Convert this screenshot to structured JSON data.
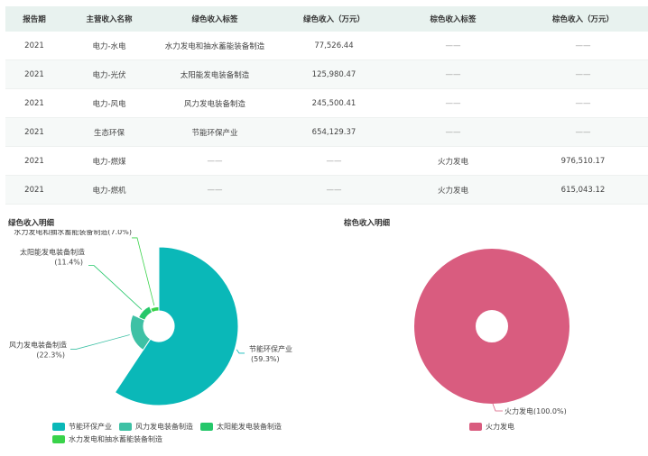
{
  "table": {
    "headers": [
      "报告期",
      "主营收入名称",
      "绿色收入标签",
      "绿色收入（万元）",
      "棕色收入标签",
      "棕色收入（万元）"
    ],
    "rows": [
      [
        "2021",
        "电力-水电",
        "水力发电和抽水蓄能装备制造",
        "77,526.44",
        "——",
        "——"
      ],
      [
        "2021",
        "电力-光伏",
        "太阳能发电装备制造",
        "125,980.47",
        "——",
        "——"
      ],
      [
        "2021",
        "电力-风电",
        "风力发电装备制造",
        "245,500.41",
        "——",
        "——"
      ],
      [
        "2021",
        "生态环保",
        "节能环保产业",
        "654,129.37",
        "——",
        "——"
      ],
      [
        "2021",
        "电力-燃煤",
        "——",
        "——",
        "火力发电",
        "976,510.17"
      ],
      [
        "2021",
        "电力-燃机",
        "——",
        "——",
        "火力发电",
        "615,043.12"
      ]
    ]
  },
  "green_section_title": "绿色收入明细",
  "brown_section_title": "棕色收入明细",
  "chart_data": [
    {
      "type": "pie",
      "variant": "rose",
      "series": [
        {
          "name": "节能环保产业",
          "value": 654129.37,
          "percent": "59.3%",
          "color": "#0ab8b8"
        },
        {
          "name": "风力发电装备制造",
          "value": 245500.41,
          "percent": "22.3%",
          "color": "#3ec1a5"
        },
        {
          "name": "太阳能发电装备制造",
          "value": 125980.47,
          "percent": "11.4%",
          "color": "#25c76a"
        },
        {
          "name": "水力发电和抽水蓄能装备制造",
          "value": 77526.44,
          "percent": "7.0%",
          "color": "#39d34a"
        }
      ]
    },
    {
      "type": "pie",
      "variant": "donut",
      "series": [
        {
          "name": "火力发电",
          "value": 1591553.29,
          "percent": "100.0%",
          "color": "#d95c7f"
        }
      ]
    }
  ]
}
